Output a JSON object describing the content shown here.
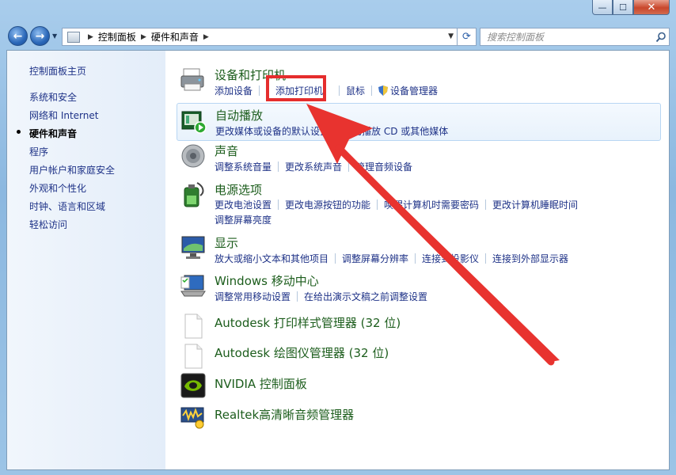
{
  "window": {
    "minimize_glyph": "—",
    "maximize_glyph": "☐",
    "close_glyph": "✕"
  },
  "nav": {
    "back_glyph": "←",
    "forward_glyph": "→",
    "refresh_glyph": "⟳",
    "breadcrumb": [
      "控制面板",
      "硬件和声音"
    ],
    "search_placeholder": "搜索控制面板"
  },
  "sidebar": {
    "items": [
      {
        "label": "控制面板主页",
        "current": false
      },
      {
        "label": "系统和安全",
        "current": false
      },
      {
        "label": "网络和 Internet",
        "current": false
      },
      {
        "label": "硬件和声音",
        "current": true
      },
      {
        "label": "程序",
        "current": false
      },
      {
        "label": "用户帐户和家庭安全",
        "current": false
      },
      {
        "label": "外观和个性化",
        "current": false
      },
      {
        "label": "时钟、语言和区域",
        "current": false
      },
      {
        "label": "轻松访问",
        "current": false
      }
    ]
  },
  "categories": [
    {
      "title": "设备和打印机",
      "icon": "printer-icon",
      "rows": [
        [
          "添加设备",
          "添加打印机",
          "鼠标",
          "设备管理器"
        ]
      ]
    },
    {
      "title": "自动播放",
      "icon": "autoplay-icon",
      "rows": [
        [
          "更改媒体或设备的默认设置",
          "自动播放 CD 或其他媒体"
        ]
      ]
    },
    {
      "title": "声音",
      "icon": "speaker-icon",
      "rows": [
        [
          "调整系统音量",
          "更改系统声音",
          "管理音频设备"
        ]
      ]
    },
    {
      "title": "电源选项",
      "icon": "battery-icon",
      "rows": [
        [
          "更改电池设置",
          "更改电源按钮的功能",
          "唤醒计算机时需要密码",
          "更改计算机睡眠时间"
        ],
        [
          "调整屏幕亮度"
        ]
      ]
    },
    {
      "title": "显示",
      "icon": "monitor-icon",
      "rows": [
        [
          "放大或缩小文本和其他项目",
          "调整屏幕分辨率",
          "连接到投影仪",
          "连接到外部显示器"
        ]
      ]
    },
    {
      "title": "Windows 移动中心",
      "icon": "mobility-center-icon",
      "rows": [
        [
          "调整常用移动设置",
          "在给出演示文稿之前调整设置"
        ]
      ]
    },
    {
      "title": "Autodesk 打印样式管理器 (32 位)",
      "icon": "document-icon",
      "rows": []
    },
    {
      "title": "Autodesk 绘图仪管理器 (32 位)",
      "icon": "document-icon",
      "rows": []
    },
    {
      "title": "NVIDIA 控制面板",
      "icon": "nvidia-icon",
      "rows": []
    },
    {
      "title": "Realtek高清晰音频管理器",
      "icon": "realtek-audio-icon",
      "rows": []
    }
  ],
  "colors": {
    "link": "#1e3287",
    "category_title": "#1c5d1c",
    "annotation": "#e52d2d"
  }
}
